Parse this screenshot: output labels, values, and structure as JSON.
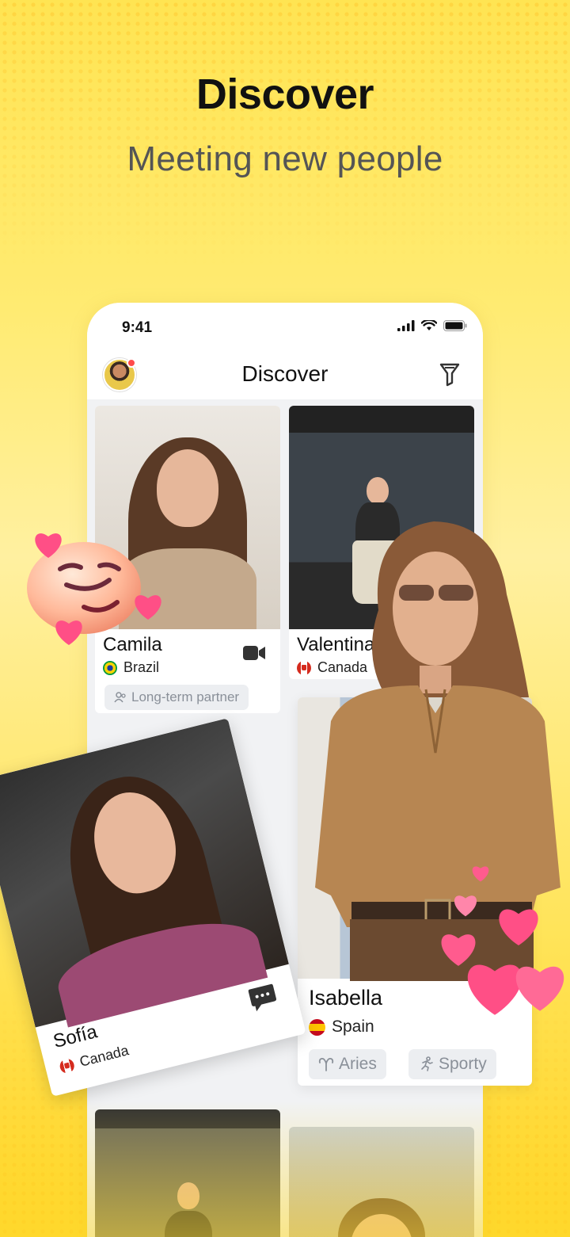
{
  "hero": {
    "title": "Discover",
    "subtitle": "Meeting new people"
  },
  "status_bar": {
    "time": "9:41"
  },
  "app_header": {
    "title": "Discover"
  },
  "cards": {
    "camila": {
      "name": "Camila",
      "country": "Brazil",
      "chip": "Long-term partner"
    },
    "valentina": {
      "name": "Valentina",
      "country": "Canada"
    },
    "sofia": {
      "name": "Sofía",
      "country": "Canada"
    },
    "isabella": {
      "name": "Isabella",
      "country": "Spain",
      "chips": [
        "Aries",
        "Sporty"
      ]
    }
  },
  "icons": {
    "avatar": "avatar",
    "filter": "filter-icon",
    "video": "video-camera-icon",
    "chat": "chat-bubble-icon",
    "partner": "people-icon",
    "aries": "aries-icon",
    "sporty": "running-icon"
  },
  "colors": {
    "accent_yellow": "#ffe452",
    "heart_pink": "#ff4f86",
    "notification_red": "#ff4b4b"
  }
}
